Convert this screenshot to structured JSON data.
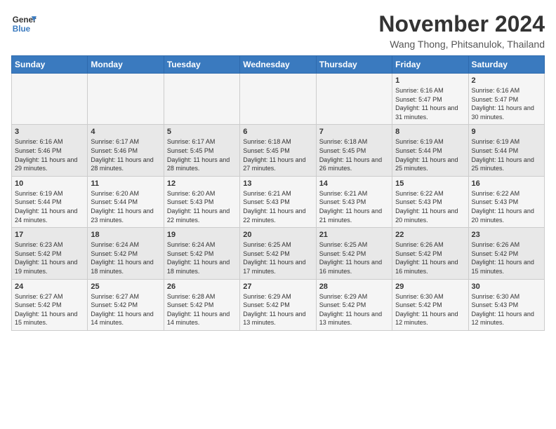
{
  "logo": {
    "line1": "General",
    "line2": "Blue"
  },
  "title": "November 2024",
  "location": "Wang Thong, Phitsanulok, Thailand",
  "days_of_week": [
    "Sunday",
    "Monday",
    "Tuesday",
    "Wednesday",
    "Thursday",
    "Friday",
    "Saturday"
  ],
  "weeks": [
    [
      {
        "day": "",
        "info": ""
      },
      {
        "day": "",
        "info": ""
      },
      {
        "day": "",
        "info": ""
      },
      {
        "day": "",
        "info": ""
      },
      {
        "day": "",
        "info": ""
      },
      {
        "day": "1",
        "info": "Sunrise: 6:16 AM\nSunset: 5:47 PM\nDaylight: 11 hours and 31 minutes."
      },
      {
        "day": "2",
        "info": "Sunrise: 6:16 AM\nSunset: 5:47 PM\nDaylight: 11 hours and 30 minutes."
      }
    ],
    [
      {
        "day": "3",
        "info": "Sunrise: 6:16 AM\nSunset: 5:46 PM\nDaylight: 11 hours and 29 minutes."
      },
      {
        "day": "4",
        "info": "Sunrise: 6:17 AM\nSunset: 5:46 PM\nDaylight: 11 hours and 28 minutes."
      },
      {
        "day": "5",
        "info": "Sunrise: 6:17 AM\nSunset: 5:45 PM\nDaylight: 11 hours and 28 minutes."
      },
      {
        "day": "6",
        "info": "Sunrise: 6:18 AM\nSunset: 5:45 PM\nDaylight: 11 hours and 27 minutes."
      },
      {
        "day": "7",
        "info": "Sunrise: 6:18 AM\nSunset: 5:45 PM\nDaylight: 11 hours and 26 minutes."
      },
      {
        "day": "8",
        "info": "Sunrise: 6:19 AM\nSunset: 5:44 PM\nDaylight: 11 hours and 25 minutes."
      },
      {
        "day": "9",
        "info": "Sunrise: 6:19 AM\nSunset: 5:44 PM\nDaylight: 11 hours and 25 minutes."
      }
    ],
    [
      {
        "day": "10",
        "info": "Sunrise: 6:19 AM\nSunset: 5:44 PM\nDaylight: 11 hours and 24 minutes."
      },
      {
        "day": "11",
        "info": "Sunrise: 6:20 AM\nSunset: 5:44 PM\nDaylight: 11 hours and 23 minutes."
      },
      {
        "day": "12",
        "info": "Sunrise: 6:20 AM\nSunset: 5:43 PM\nDaylight: 11 hours and 22 minutes."
      },
      {
        "day": "13",
        "info": "Sunrise: 6:21 AM\nSunset: 5:43 PM\nDaylight: 11 hours and 22 minutes."
      },
      {
        "day": "14",
        "info": "Sunrise: 6:21 AM\nSunset: 5:43 PM\nDaylight: 11 hours and 21 minutes."
      },
      {
        "day": "15",
        "info": "Sunrise: 6:22 AM\nSunset: 5:43 PM\nDaylight: 11 hours and 20 minutes."
      },
      {
        "day": "16",
        "info": "Sunrise: 6:22 AM\nSunset: 5:43 PM\nDaylight: 11 hours and 20 minutes."
      }
    ],
    [
      {
        "day": "17",
        "info": "Sunrise: 6:23 AM\nSunset: 5:42 PM\nDaylight: 11 hours and 19 minutes."
      },
      {
        "day": "18",
        "info": "Sunrise: 6:24 AM\nSunset: 5:42 PM\nDaylight: 11 hours and 18 minutes."
      },
      {
        "day": "19",
        "info": "Sunrise: 6:24 AM\nSunset: 5:42 PM\nDaylight: 11 hours and 18 minutes."
      },
      {
        "day": "20",
        "info": "Sunrise: 6:25 AM\nSunset: 5:42 PM\nDaylight: 11 hours and 17 minutes."
      },
      {
        "day": "21",
        "info": "Sunrise: 6:25 AM\nSunset: 5:42 PM\nDaylight: 11 hours and 16 minutes."
      },
      {
        "day": "22",
        "info": "Sunrise: 6:26 AM\nSunset: 5:42 PM\nDaylight: 11 hours and 16 minutes."
      },
      {
        "day": "23",
        "info": "Sunrise: 6:26 AM\nSunset: 5:42 PM\nDaylight: 11 hours and 15 minutes."
      }
    ],
    [
      {
        "day": "24",
        "info": "Sunrise: 6:27 AM\nSunset: 5:42 PM\nDaylight: 11 hours and 15 minutes."
      },
      {
        "day": "25",
        "info": "Sunrise: 6:27 AM\nSunset: 5:42 PM\nDaylight: 11 hours and 14 minutes."
      },
      {
        "day": "26",
        "info": "Sunrise: 6:28 AM\nSunset: 5:42 PM\nDaylight: 11 hours and 14 minutes."
      },
      {
        "day": "27",
        "info": "Sunrise: 6:29 AM\nSunset: 5:42 PM\nDaylight: 11 hours and 13 minutes."
      },
      {
        "day": "28",
        "info": "Sunrise: 6:29 AM\nSunset: 5:42 PM\nDaylight: 11 hours and 13 minutes."
      },
      {
        "day": "29",
        "info": "Sunrise: 6:30 AM\nSunset: 5:42 PM\nDaylight: 11 hours and 12 minutes."
      },
      {
        "day": "30",
        "info": "Sunrise: 6:30 AM\nSunset: 5:43 PM\nDaylight: 11 hours and 12 minutes."
      }
    ]
  ]
}
